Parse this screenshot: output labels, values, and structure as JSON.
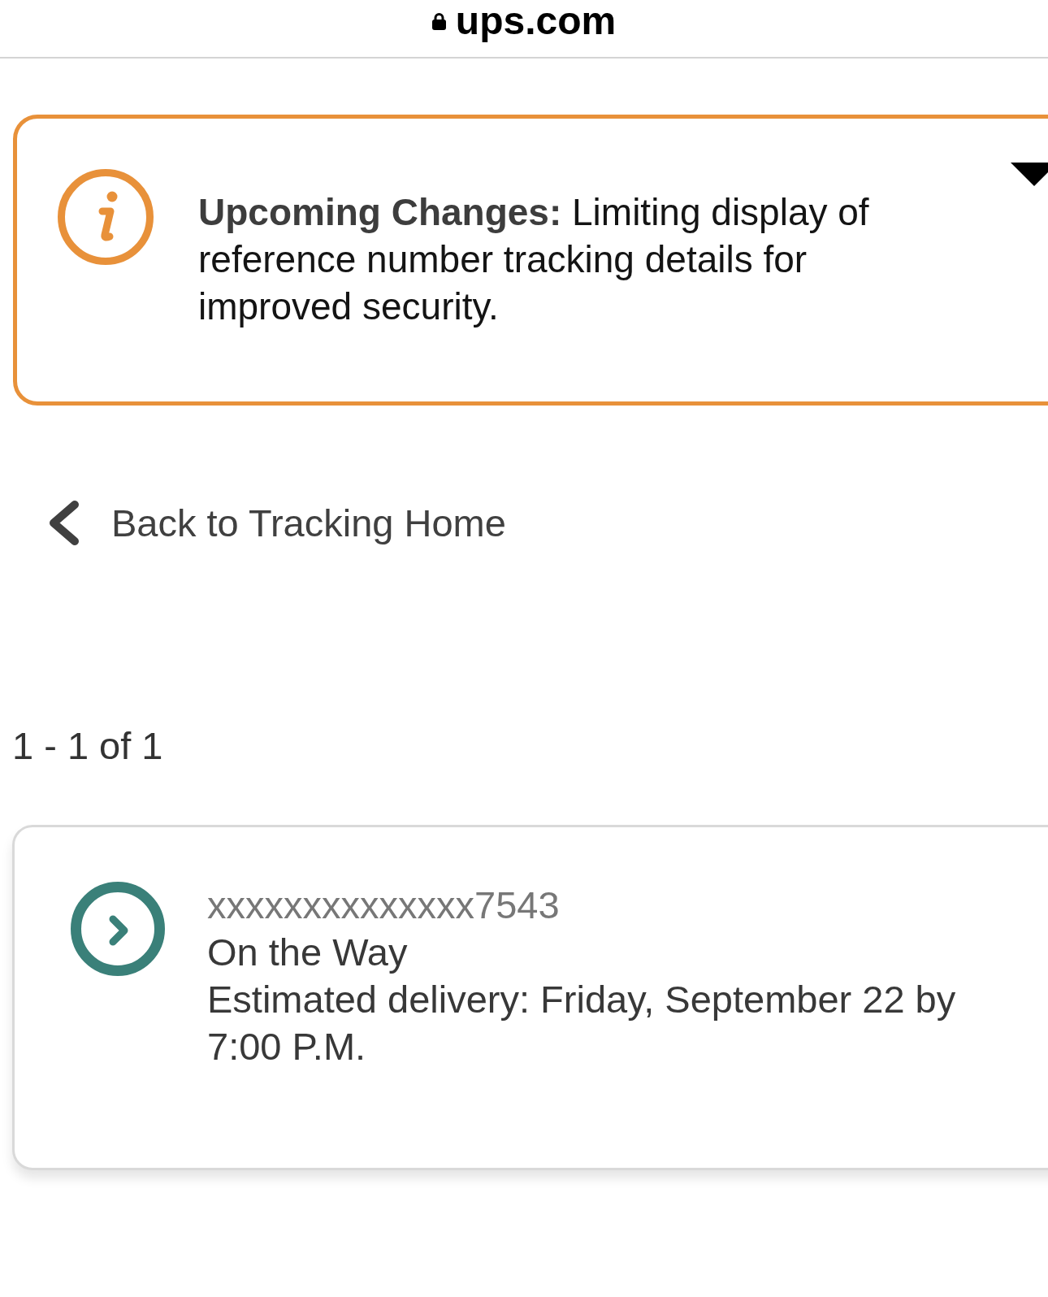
{
  "browser_bar": {
    "secure": true,
    "url": "ups.com"
  },
  "alert": {
    "message": "**Upcoming Changes:** Limiting display of reference number tracking details for improved security."
  },
  "back_link": {
    "label": "Back to Tracking Home"
  },
  "results": {
    "count_label": "1 - 1 of 1"
  },
  "shipments": [
    {
      "tracking_number": "xxxxxxxxxxxxxx7543",
      "status": "On the Way",
      "estimated_delivery": "Estimated delivery: Friday, September 22 by 7:00 P.M."
    }
  ]
}
